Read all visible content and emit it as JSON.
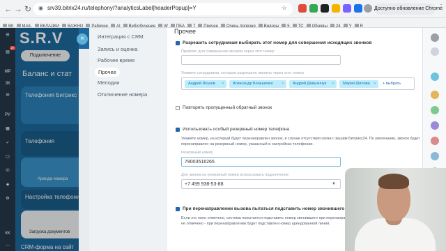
{
  "browser": {
    "url": "srv39.bitrix24.ru/telephony/?analyticsLabel[headerPopup]=Y",
    "update_button": "Доступно обновление Chrome",
    "bookmarks": [
      "ВК",
      "MAIL",
      "ВКЛАДКИ",
      "ВАЖНО",
      "Рабочие",
      "AI",
      "Веб/обучение",
      "W",
      "ПБА",
      "7",
      "Прочее",
      "Очень полезно",
      "Видосы",
      "5",
      "TC",
      "Обновы",
      "24",
      "Y",
      "R"
    ]
  },
  "rail": {
    "items": [
      "MP",
      "ЗК",
      "РУ",
      "КК"
    ],
    "badge": "27"
  },
  "background": {
    "logo": "S.R.V",
    "tab": "Подключение",
    "title": "Баланс и стат",
    "card1": "Телефония Битрикс",
    "card2": "Телефония",
    "card3": "Аренда номера",
    "card4": "Настройка телефонии",
    "card5": "Загрузка документов",
    "footer": "CRM-форма на сайт"
  },
  "panel_nav": {
    "items": [
      {
        "label": "Интеграция с CRM",
        "active": false
      },
      {
        "label": "Запись и оценка",
        "active": false
      },
      {
        "label": "Рабочее время",
        "active": false
      },
      {
        "label": "Прочее",
        "active": true
      },
      {
        "label": "Мелодии",
        "active": false
      },
      {
        "label": "Отключение номера",
        "active": false
      }
    ]
  },
  "settings": {
    "section_title": "Прочее",
    "outgoing_choice": {
      "label": "Разрешить сотрудникам выбирать этот номер для совершения исходящих звонков",
      "prefix_hint": "Префикс для совершения звонков через этот номер",
      "prefix_value": "",
      "users_hint": "Укажите сотрудников, которым разрешено звонить через этот номер",
      "users": [
        "Андрей Яськов",
        "Александр Большенко",
        "Андрей Демьянчук",
        "Мария Шилова"
      ],
      "add_link": "+ выбрать"
    },
    "repeat_callback": {
      "label": "Повторять пропущенный обратный звонок"
    },
    "backup_number": {
      "label": "Использовать особый резервный номер телефона",
      "description": "Укажите номер, на который будет перенаправлен звонок, в случае отсутствия связи с вашим Битрикс24. По умолчанию, звонок будет перенаправлен на резервный номер, указанный в настройках телефонии.",
      "number_hint": "Резервный номер",
      "number_value": "79003516265",
      "via_hint": "Для звонка на резервный номер использовать подключение",
      "via_value": "+7 499 938-53-88"
    },
    "substitute": {
      "label": "При перенаправлении вызова пытаться подставить номер звонившего",
      "description": "Если это поле отмечено, система попытается подставить номер звонившего при перенаправлении звонка на номер сотрудника. Если не отмечено - при перенаправлении будет подставлен номер арендованной линии."
    }
  }
}
